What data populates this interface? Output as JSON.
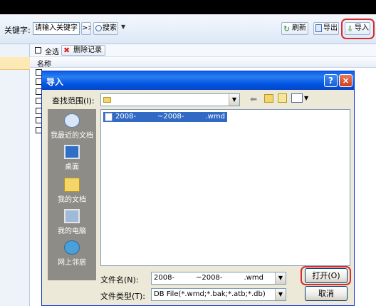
{
  "toolbar": {
    "keyword_label": "关键字:",
    "keyword_placeholder": "请输入关键字",
    "more_label": ">>",
    "search_label": "搜索",
    "refresh_label": "刷新",
    "export_label": "导出",
    "import_label": "导入"
  },
  "list": {
    "select_all_label": "全选",
    "delete_label": "删除记录",
    "column_name": "名称"
  },
  "dialog": {
    "title": "导入",
    "help_label": "?",
    "close_label": "×",
    "look_in_label": "查找范围(I):",
    "look_in_value": "",
    "places": [
      {
        "label": "我最近的文档",
        "icon": "recent-documents-icon"
      },
      {
        "label": "桌面",
        "icon": "desktop-icon"
      },
      {
        "label": "我的文档",
        "icon": "my-documents-icon"
      },
      {
        "label": "我的电脑",
        "icon": "my-computer-icon"
      },
      {
        "label": "网上邻居",
        "icon": "network-places-icon"
      }
    ],
    "files": [
      {
        "name": "2008-　　　~2008-　　　.wmd"
      }
    ],
    "filename_label": "文件名(N):",
    "filename_value": "2008-　　　~2008-　　　.wmd",
    "filetype_label": "文件类型(T):",
    "filetype_value": "DB File(*.wmd;*.bak;*.atb;*.db)",
    "open_label": "打开(O)",
    "cancel_label": "取消"
  },
  "colors": {
    "title_bar": "#0054e3",
    "highlight": "#316ac5",
    "annotation_ring": "#d92b2b",
    "dialog_bg": "#ece9d8"
  }
}
